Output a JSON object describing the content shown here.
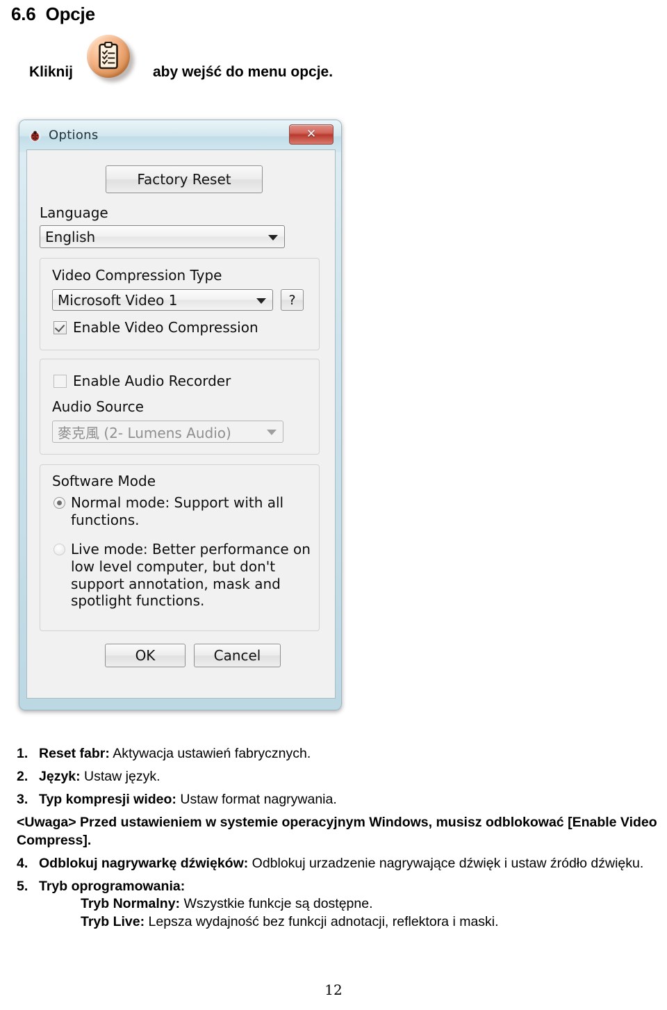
{
  "document": {
    "heading": "6.6  Opcje",
    "click_instruction": {
      "before": "Kliknij",
      "icon": "options-clipboard-icon",
      "after": "aby wejść do menu opcje."
    },
    "page_number": "12"
  },
  "dialog": {
    "title": "Options",
    "title_icon": "ladybug-icon",
    "close_label": "✕",
    "factory_reset_label": "Factory Reset",
    "language": {
      "label": "Language",
      "value": "English"
    },
    "video": {
      "label": "Video Compression Type",
      "value": "Microsoft Video 1",
      "help_label": "?",
      "checkbox_label": "Enable Video Compression",
      "checkbox_checked": "checked"
    },
    "audio": {
      "checkbox_label": "Enable Audio Recorder",
      "checkbox_checked": "unchecked",
      "source_label": "Audio Source",
      "source_value": "麥克風 (2- Lumens Audio)"
    },
    "software_mode": {
      "label": "Software Mode",
      "option_normal": "Normal mode: Support with all functions.",
      "option_live": "Live mode: Better performance on low level computer, but don't support annotation, mask and spotlight functions.",
      "selected": "normal"
    },
    "ok_label": "OK",
    "cancel_label": "Cancel"
  },
  "notes": {
    "items": [
      {
        "num": "1.",
        "bold": "Reset fabr:",
        "text": " Aktywacja ustawień fabrycznych."
      },
      {
        "num": "2.",
        "bold": "Język:",
        "text": " Ustaw język."
      },
      {
        "num": "3.",
        "bold": "Typ kompresji wideo:",
        "text": " Ustaw format nagrywania."
      }
    ],
    "warning": "<Uwaga> Przed ustawieniem w systemie operacyjnym Windows, musisz odblokować [Enable Video Compress].",
    "item4": {
      "num": "4.",
      "bold": "Odblokuj nagrywarkę dźwięków:",
      "text": " Odblokuj urzadzenie nagrywające dźwięk i ustaw źródło dźwięku."
    },
    "item5": {
      "num": "5.",
      "bold": "Tryb oprogramowania:",
      "sub_normal_bold": "Tryb Normalny:",
      "sub_normal_text": " Wszystkie funkcje są dostępne.",
      "sub_live_bold": "Tryb Live:",
      "sub_live_text": " Lepsza wydajność bez funkcji adnotacji, reflektora i maski."
    }
  },
  "colors": {
    "accent_orange": "#f4b183",
    "close_red": "#b93a2e",
    "dialog_blue": "#cfe4ec"
  }
}
